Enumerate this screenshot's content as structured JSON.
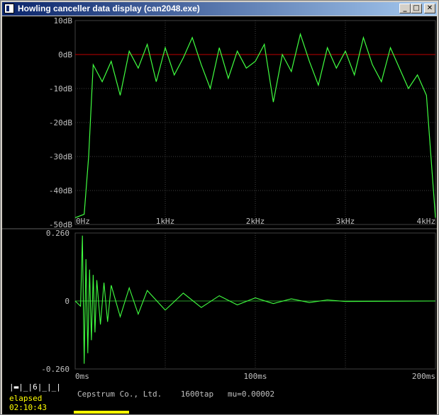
{
  "window": {
    "title": "Howling canceller data display (can2048.exe)",
    "buttons": {
      "minimize": "_",
      "maximize": "□",
      "close": "✕"
    }
  },
  "colors": {
    "trace": "#40ff40",
    "reference_line": "#c00000",
    "grid": "#404040",
    "axis_text": "#c0c0c0",
    "status_yellow": "#ffff00"
  },
  "chart_data": [
    {
      "type": "line",
      "y_ticks": [
        "10dB",
        "0dB",
        "-10dB",
        "-20dB",
        "-30dB",
        "-40dB",
        "-50dB"
      ],
      "x_ticks": [
        "0Hz",
        "1kHz",
        "2kHz",
        "3kHz",
        "4kHz"
      ],
      "ylim": [
        -50,
        10
      ],
      "xlim": [
        0,
        4000
      ],
      "reference_line_db": 0,
      "grid": true,
      "series": [
        {
          "x": [
            0,
            100,
            150,
            200,
            300,
            400,
            500,
            600,
            700,
            800,
            900,
            1000,
            1100,
            1200,
            1300,
            1400,
            1500,
            1600,
            1700,
            1800,
            1900,
            2000,
            2100,
            2200,
            2300,
            2400,
            2500,
            2600,
            2700,
            2800,
            2900,
            3000,
            3100,
            3200,
            3300,
            3400,
            3500,
            3600,
            3700,
            3800,
            3900,
            4000
          ],
          "values": [
            -48,
            -47,
            -30,
            -3,
            -8,
            -2,
            -12,
            1,
            -4,
            3,
            -8,
            2,
            -6,
            -1,
            5,
            -3,
            -10,
            2,
            -7,
            1,
            -4,
            -2,
            3,
            -14,
            0,
            -5,
            6,
            -2,
            -9,
            2,
            -4,
            1,
            -6,
            5,
            -3,
            -8,
            2,
            -4,
            -10,
            -6,
            -12,
            -48
          ]
        }
      ]
    },
    {
      "type": "line",
      "y_ticks": [
        "0.260",
        "0",
        "-0.260"
      ],
      "x_ticks": [
        "0ms",
        "100ms",
        "200ms"
      ],
      "ylim": [
        -0.26,
        0.26
      ],
      "xlim": [
        0,
        200
      ],
      "grid": true,
      "series": [
        {
          "x": [
            0,
            3,
            4,
            5,
            6,
            7,
            8,
            9,
            10,
            11,
            12,
            14,
            16,
            18,
            20,
            25,
            30,
            35,
            40,
            50,
            60,
            70,
            80,
            90,
            100,
            110,
            120,
            130,
            140,
            150,
            200
          ],
          "values": [
            0,
            -0.02,
            0.25,
            -0.24,
            0.16,
            -0.2,
            0.12,
            -0.15,
            0.1,
            -0.12,
            0.08,
            -0.09,
            0.07,
            -0.08,
            0.06,
            -0.06,
            0.05,
            -0.05,
            0.04,
            -0.035,
            0.03,
            -0.025,
            0.02,
            -0.015,
            0.012,
            -0.01,
            0.008,
            -0.006,
            0.004,
            -0.002,
            0
          ]
        }
      ]
    }
  ],
  "status": {
    "tabs": "|▬|_|6|_|_|",
    "company": "Cepstrum Co., Ltd.",
    "taps": "1600tap",
    "mu": "mu=0.00002",
    "elapsed_label": "elapsed",
    "elapsed_time": "02:10:43",
    "progress": 0.15
  }
}
